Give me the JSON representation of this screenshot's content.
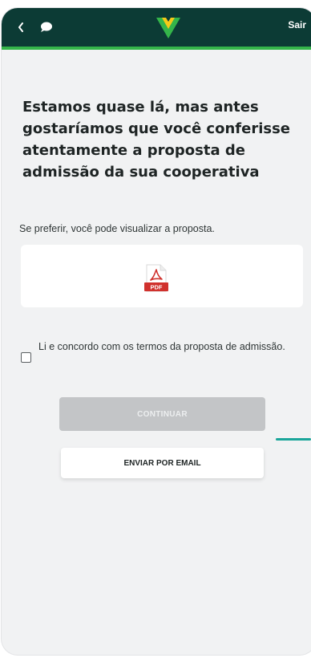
{
  "header": {
    "back_icon": "chevron-left-icon",
    "chat_icon": "chat-bubble-icon",
    "logo_icon": "sicredi-v-logo",
    "exit_label": "Sair",
    "bar_color": "#0c3b35",
    "accent_color": "#34b54a"
  },
  "main": {
    "title": "Estamos quase lá, mas antes gostaríamos que você conferisse atentamente a proposta de admissão da sua cooperativa",
    "hint": "Se preferir, você pode visualizar a proposta.",
    "pdf": {
      "icon": "pdf-file-icon",
      "badge": "PDF"
    },
    "agree": {
      "checked": false,
      "label": "Li e concordo com os termos da proposta de admissão."
    },
    "continue_label": "CONTINUAR",
    "email_label": "ENVIAR POR EMAIL"
  }
}
